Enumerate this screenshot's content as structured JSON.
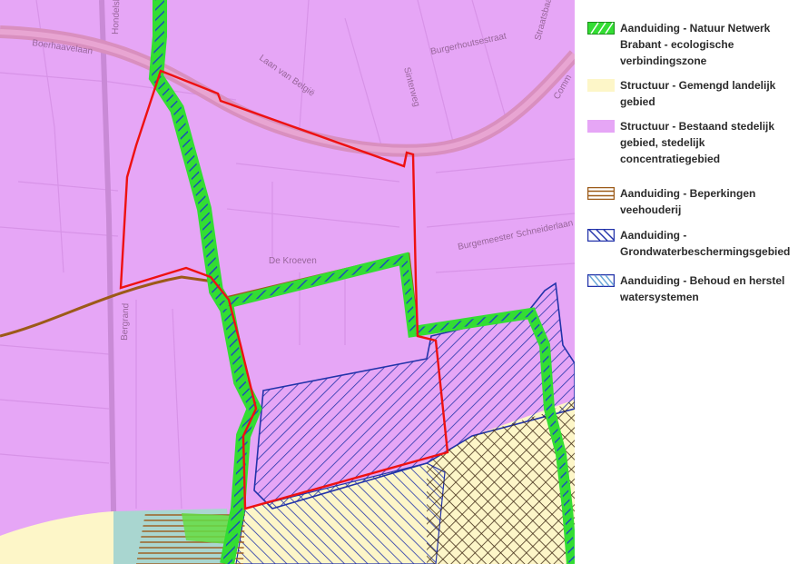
{
  "map": {
    "road_labels": {
      "boerhaavelaan": "Boerhaavelaan",
      "hondelsbek": "Hondelsbeek",
      "laan_van_belgie": "Laan van België",
      "burgerhoutsestraat": "Burgerhoutsestraat",
      "sinterweg": "Sinterweg",
      "straatsbaan": "Straatsbaan",
      "burgemeester": "Burgemeester Schneiderlaan",
      "de_kroeven": "De Kroeven",
      "bergrand": "Bergrand",
      "comm": "Comm"
    }
  },
  "legend": {
    "items": [
      {
        "label": "Aanduiding - Natuur Netwerk Brabant - ecologische verbindingszone",
        "swatch": "green-hatch-icon"
      },
      {
        "label": "Structuur - Gemengd landelijk gebied",
        "swatch": "yellow-fill-icon"
      },
      {
        "label": "Structuur - Bestaand stedelijk gebied, stedelijk concentratiegebied",
        "swatch": "purple-fill-icon"
      },
      {
        "label": "Aanduiding - Beperkingen veehouderij",
        "swatch": "brown-lines-icon"
      },
      {
        "label": "Aanduiding - Grondwaterbeschermingsgebied",
        "swatch": "blue-hatch-icon"
      },
      {
        "label": "Aanduiding - Behoud en herstel watersystemen",
        "swatch": "blue-backhatch-icon"
      }
    ]
  },
  "colors": {
    "urban": "#e6a6f6",
    "rural": "#fdf6c8",
    "eco_green": "#33dd33",
    "boundary_red": "#ee1111",
    "livestock_brown": "#9c5a18",
    "groundwater_blue": "#2233aa",
    "water_blue": "#6aa8d8"
  }
}
